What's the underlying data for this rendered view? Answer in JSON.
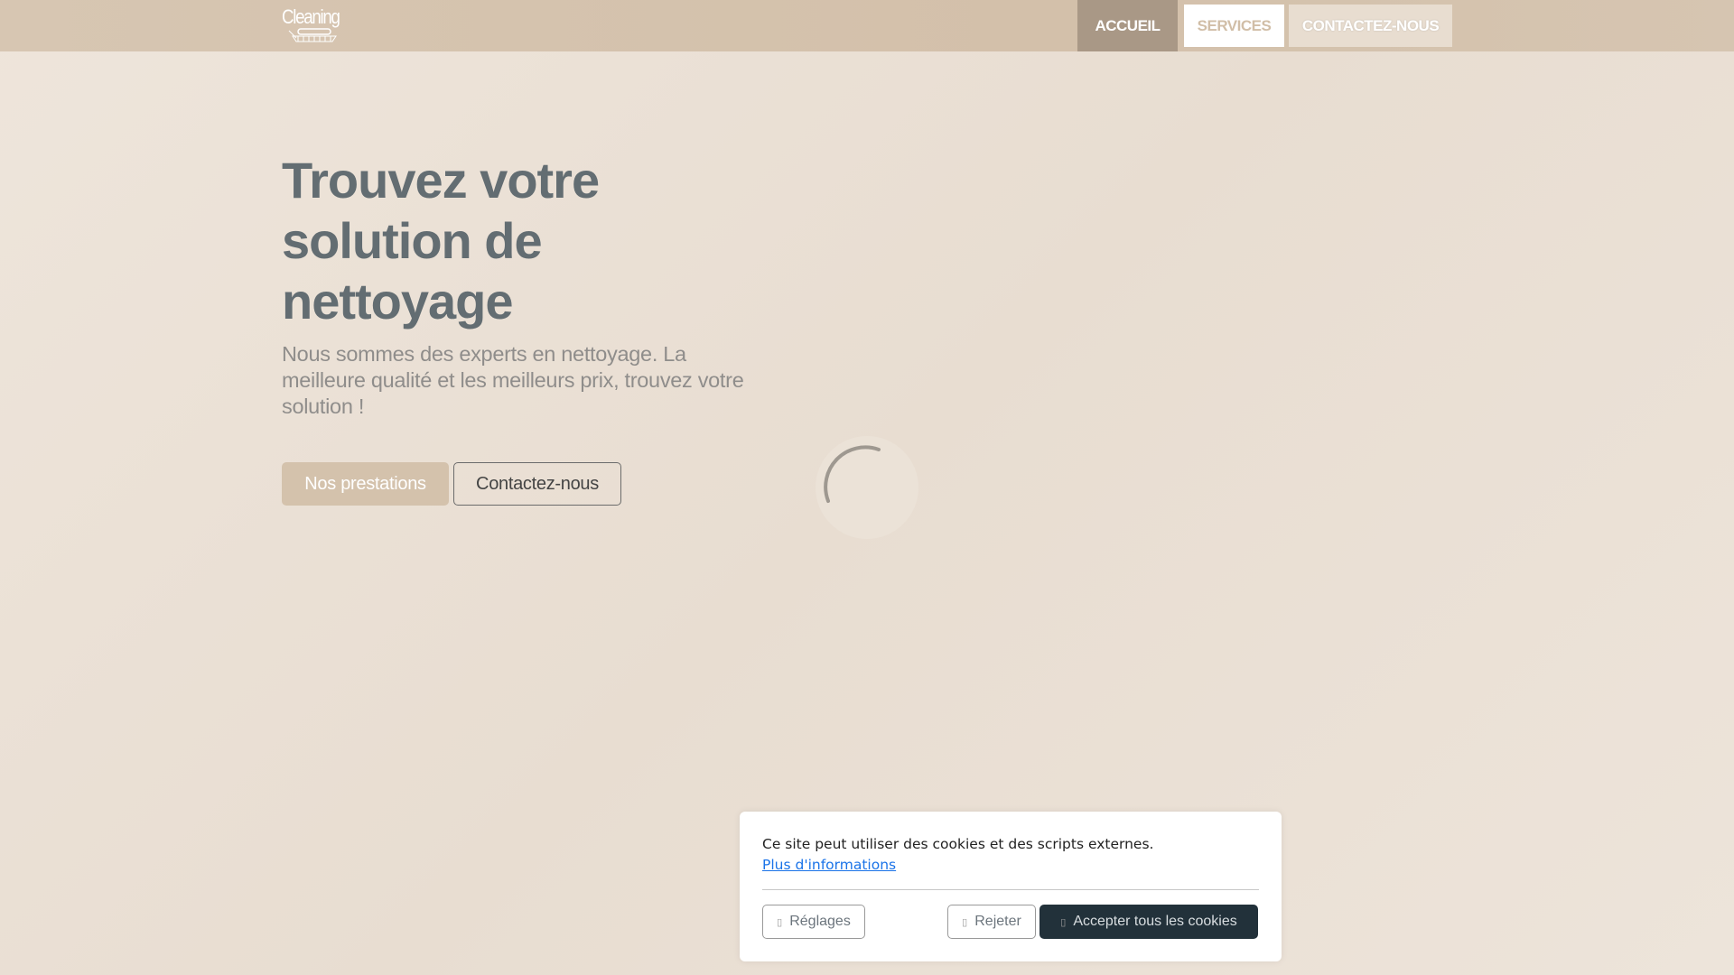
{
  "nav": {
    "logo": "Cleaning",
    "items": [
      {
        "label": "ACCUEIL"
      },
      {
        "label": "SERVICES"
      },
      {
        "label": "CONTACTEZ-NOUS"
      }
    ]
  },
  "hero": {
    "title": "Trouvez votre solution de nettoyage",
    "lead": "Nous sommes des experts en nettoyage. La meilleure qualité et les meilleurs prix, trouvez votre solution !",
    "primary": "Nos prestations",
    "secondary": "Contactez-nous"
  },
  "cookie": {
    "text": "Ce site peut utiliser des cookies et des scripts externes.",
    "link": "Plus d'informations",
    "settings": "Réglages",
    "reject": "Rejeter",
    "accept": "Accepter tous les cookies",
    "icon": "▯"
  }
}
